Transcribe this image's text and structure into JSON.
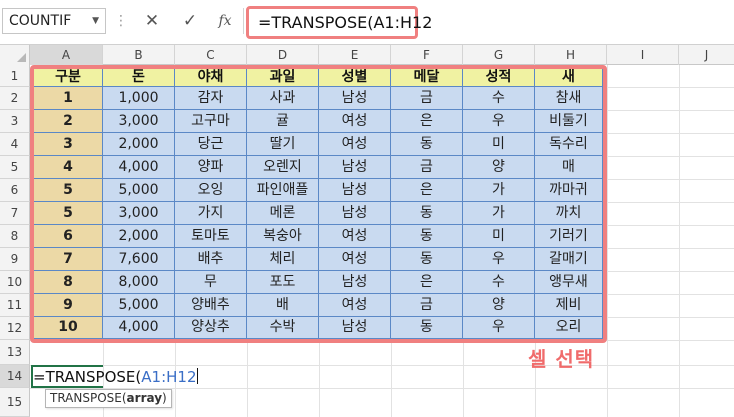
{
  "formula_bar": {
    "name_box": "COUNTIF",
    "cancel_icon": "✕",
    "enter_icon": "✓",
    "fx_label": "fx",
    "formula": "=TRANSPOSE(A1:H12"
  },
  "columns": [
    "A",
    "B",
    "C",
    "D",
    "E",
    "F",
    "G",
    "H",
    "I",
    "J"
  ],
  "rows": [
    "1",
    "2",
    "3",
    "4",
    "5",
    "6",
    "7",
    "8",
    "9",
    "10",
    "11",
    "12",
    "13",
    "14",
    "15"
  ],
  "table": {
    "headers": [
      "구분",
      "돈",
      "야채",
      "과일",
      "성별",
      "메달",
      "성적",
      "새"
    ],
    "rows": [
      [
        "1",
        "1,000",
        "감자",
        "사과",
        "남성",
        "금",
        "수",
        "참새"
      ],
      [
        "2",
        "3,000",
        "고구마",
        "귤",
        "여성",
        "은",
        "우",
        "비둘기"
      ],
      [
        "3",
        "2,000",
        "당근",
        "딸기",
        "여성",
        "동",
        "미",
        "독수리"
      ],
      [
        "4",
        "4,000",
        "양파",
        "오렌지",
        "남성",
        "금",
        "양",
        "매"
      ],
      [
        "5",
        "5,000",
        "오잉",
        "파인애플",
        "남성",
        "은",
        "가",
        "까마귀"
      ],
      [
        "5",
        "3,000",
        "가지",
        "메론",
        "남성",
        "동",
        "가",
        "까치"
      ],
      [
        "6",
        "2,000",
        "토마토",
        "복숭아",
        "여성",
        "동",
        "미",
        "기러기"
      ],
      [
        "7",
        "7,600",
        "배추",
        "체리",
        "여성",
        "동",
        "우",
        "갈매기"
      ],
      [
        "8",
        "8,000",
        "무",
        "포도",
        "남성",
        "은",
        "수",
        "앵무새"
      ],
      [
        "9",
        "5,000",
        "양배추",
        "배",
        "여성",
        "금",
        "양",
        "제비"
      ],
      [
        "10",
        "4,000",
        "양상추",
        "수박",
        "남성",
        "동",
        "우",
        "오리"
      ]
    ]
  },
  "annotation": "셀 선택",
  "editing_cell": {
    "text_prefix": "=TRANSPOSE(",
    "text_ref": "A1:H12",
    "tooltip_fn": "TRANSPOSE(",
    "tooltip_arg": "array",
    "tooltip_close": ")"
  },
  "colors": {
    "highlight_border": "#f08080",
    "header_fill": "#f0f2a2",
    "first_col_fill": "#ecd9a6",
    "data_fill": "#c9daf0",
    "cell_border": "#5b88c6",
    "active_cell_border": "#217346",
    "reference_text": "#3a6ec6"
  }
}
